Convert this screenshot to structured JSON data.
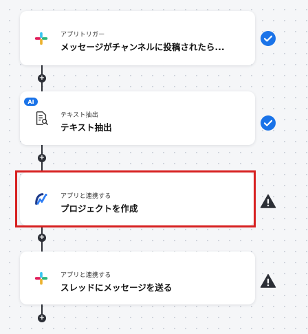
{
  "colors": {
    "connector": "#2c2f36",
    "check": "#1a73e8",
    "warning": "#2c2f36",
    "highlight": "#d72020",
    "ai_badge": "#1a73e8"
  },
  "steps": [
    {
      "subtitle": "アプリトリガー",
      "title": "メッセージがチャンネルに投稿されたら...",
      "icon": "slack-icon",
      "status": "check-circle-icon"
    },
    {
      "badge": "AI",
      "subtitle": "テキスト抽出",
      "title": "テキスト抽出",
      "icon": "document-search-icon",
      "status": "check-circle-icon"
    },
    {
      "subtitle": "アプリと連携する",
      "title": "プロジェクトを作成",
      "icon": "app-logo-icon",
      "status": "warning-icon",
      "selected": true
    },
    {
      "subtitle": "アプリと連携する",
      "title": "スレッドにメッセージを送る",
      "icon": "slack-icon",
      "status": "warning-icon"
    }
  ],
  "add_symbol": "+"
}
